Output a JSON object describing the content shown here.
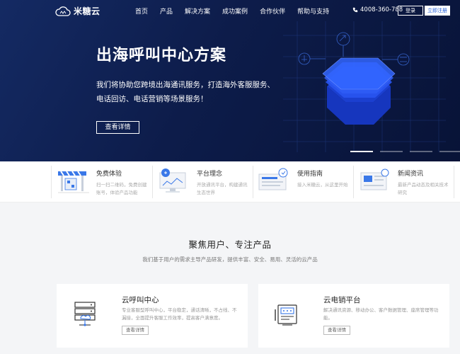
{
  "brand": {
    "name": "米糖云"
  },
  "nav": {
    "items": [
      "首页",
      "产品",
      "解决方案",
      "成功案例",
      "合作伙伴",
      "帮助与支持"
    ],
    "phone": "4008-360-788",
    "login": "登录",
    "register": "立即注册"
  },
  "hero": {
    "title": "出海呼叫中心方案",
    "desc": "我们将协助您跨境出海通讯服务，打造海外客服服务、电话回访、电话营销等场景服务！",
    "button": "查看详情",
    "slides": 4,
    "active_slide": 1
  },
  "features": [
    {
      "title": "免费体验",
      "desc": "扫一扫二维码，免费创建账号，体验产品功能",
      "icon": "barrier-icon"
    },
    {
      "title": "平台理念",
      "desc": "开放通讯平台，构建通讯生态世界",
      "icon": "monitor-bulb-icon"
    },
    {
      "title": "使用指南",
      "desc": "接入米糖云，从这里开始",
      "icon": "guide-icon"
    },
    {
      "title": "新闻资讯",
      "desc": "最新产品动态及相关技术研究",
      "icon": "news-icon"
    }
  ],
  "section": {
    "title": "聚焦用户、专注产品",
    "subtitle": "我们基于用户的需求主导产品研发，提供丰富、安全、易用、灵活的云产品"
  },
  "cards": [
    {
      "title": "云呼叫中心",
      "desc": "专业客服型呼叫中心，平台稳定，通话清晰，不占线、不漏接，全面提升客服工作效率，提高客户满意度。",
      "button": "查看详情",
      "icon": "server-cloud-icon"
    },
    {
      "title": "云电销平台",
      "desc": "解决通讯资源、移动办公、客户数据管理、座席管理等功能。",
      "button": "查看详情",
      "icon": "phone-terminal-icon"
    }
  ],
  "colors": {
    "hero_bg": "#0d1c4a",
    "accent": "#1f5bd8",
    "register_text": "#1f5bd8"
  }
}
